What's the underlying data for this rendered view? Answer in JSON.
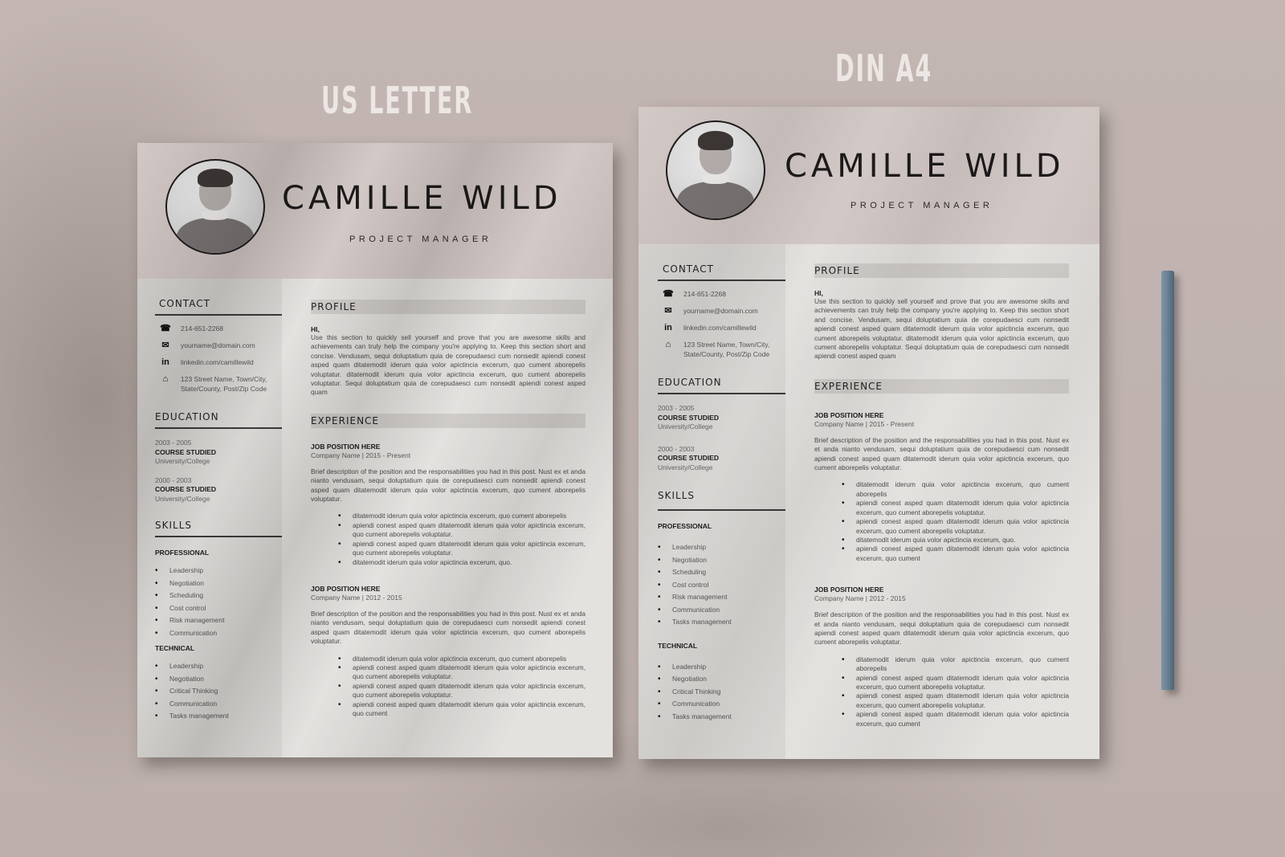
{
  "labels": {
    "us_letter": "US LETTER",
    "din_a4": "DIN A4"
  },
  "resume": {
    "name": "CAMILLE  WILD",
    "role": "PROJECT MANAGER",
    "photo_icon": "portrait-photo",
    "contact": {
      "title": "CONTACT",
      "items": [
        {
          "icon": "phone-icon",
          "glyph": "☎",
          "text": "214-651-2268"
        },
        {
          "icon": "email-icon",
          "glyph": "✉",
          "text": "yourname@domain.com"
        },
        {
          "icon": "linkedin-icon",
          "glyph": "in",
          "text": "linkedin.com/camillewild"
        },
        {
          "icon": "home-icon",
          "glyph": "⌂",
          "text": "123 Street Name, Town/City, State/County, Post/Zip Code"
        }
      ]
    },
    "education": {
      "title": "EDUCATION",
      "items": [
        {
          "years": "2003 - 2005",
          "course": "COURSE STUDIED",
          "school": "University/College"
        },
        {
          "years": "2000 - 2003",
          "course": "COURSE STUDIED",
          "school": "University/College"
        }
      ]
    },
    "skills": {
      "title": "SKILLS",
      "professional_title": "PROFESSIONAL",
      "professional_us": [
        "Leadership",
        "Negotiation",
        "Scheduling",
        "Cost control",
        "Risk management",
        "Communication"
      ],
      "professional_a4": [
        "Leadership",
        "Negotiation",
        "Scheduling",
        "Cost control",
        "Risk management",
        "Communication",
        "Tasks management"
      ],
      "technical_title": "TECHNICAL",
      "technical": [
        "Leadership",
        "Negotiation",
        "Critical Thinking",
        "Communication",
        "Tasks management"
      ]
    },
    "profile": {
      "title": "PROFILE",
      "greeting": "HI,",
      "text": "Use this section to quickly sell yourself and prove that you are awesome skills and achievements can truly help the company you're applying to. Keep this section short and concise. Vendusam, sequi doluptatium quia de corepudaesci cum nonsedit apiendi conest asped quam ditatemodit iderum quia volor apictincia excerum, quo cument aborepelis voluptatur. ditatemodit iderum quia volor apictincia excerum, quo cument aborepelis voluptatur.  Sequi doluptatium quia de corepudaesci cum nonsedit apiendi conest asped quam"
    },
    "experience": {
      "title": "EXPERIENCE",
      "jobs": [
        {
          "title": "JOB POSITION HERE",
          "meta": "Company Name | 2015 - Present",
          "desc": "Brief description of the position and the responsabilities you had in this post. Nust ex et anda nianto vendusam, sequi doluptatium quia de corepudaesci cum nonsedit apiendi conest asped quam ditatemodit iderum quia volor apictincia excerum, quo cument aborepelis voluptatur.",
          "bullets_us": [
            "ditatemodit iderum quia volor apictincia excerum, quo cument aborepelis",
            "apiendi conest asped quam ditatemodit iderum quia volor apictincia excerum, quo cument aborepelis voluptatur.",
            "apiendi conest asped quam ditatemodit iderum quia volor apictincia excerum, quo cument aborepelis voluptatur.",
            "ditatemodit iderum quia volor apictincia excerum, quo."
          ],
          "bullets_a4": [
            "ditatemodit iderum quia volor apictincia excerum, quo cument aborepelis",
            "apiendi conest asped quam ditatemodit iderum quia volor apictincia excerum, quo cument aborepelis voluptatur.",
            "apiendi conest asped quam ditatemodit iderum quia volor apictincia excerum, quo cument aborepelis voluptatur.",
            "ditatemodit iderum quia volor apictincia excerum, quo.",
            "apiendi conest asped quam ditatemodit iderum quia volor apictincia excerum, quo cument"
          ]
        },
        {
          "title": "JOB POSITION HERE",
          "meta": "Company Name | 2012 - 2015",
          "desc": "Brief description of the position and the responsabilities you had in this post. Nust ex et anda nianto vendusam, sequi doluptatium quia de corepudaesci cum nonsedit apiendi conest asped quam ditatemodit iderum quia volor apictincia excerum, quo cument aborepelis voluptatur.",
          "bullets": [
            "ditatemodit iderum quia volor apictincia excerum, quo cument aborepelis",
            "apiendi conest asped quam ditatemodit iderum quia volor apictincia excerum, quo cument aborepelis voluptatur.",
            "apiendi conest asped quam ditatemodit iderum quia volor apictincia excerum, quo cument aborepelis voluptatur.",
            "apiendi conest asped quam ditatemodit iderum quia volor apictincia excerum, quo cument"
          ]
        }
      ]
    }
  },
  "colors": {
    "background": "#bfb2ae",
    "header_band": "#d3c9c7",
    "paper": "#e4e2df",
    "pencil": "#6b8397"
  }
}
